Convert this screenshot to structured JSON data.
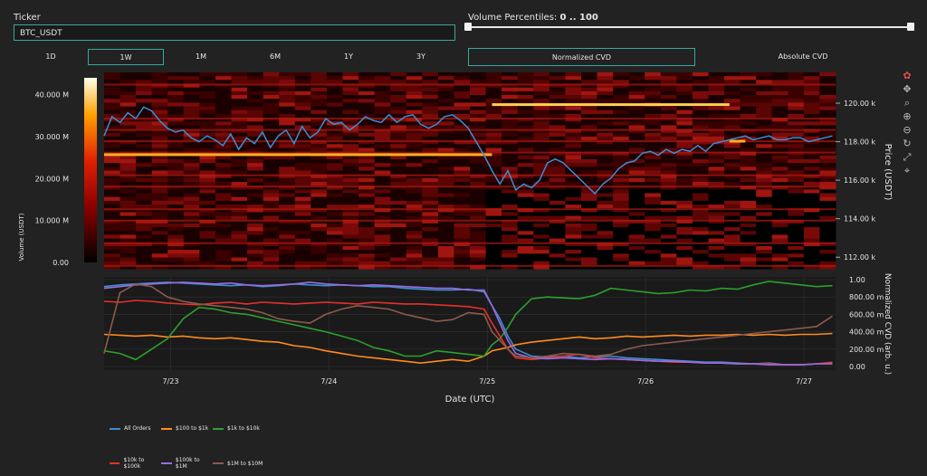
{
  "ticker": {
    "label": "Ticker",
    "value": "BTC_USDT"
  },
  "volume_filter": {
    "label": "Volume Percentiles:",
    "range_text": "0 .. 100",
    "low": 0,
    "high": 100
  },
  "timeframes": [
    {
      "label": "1D",
      "active": false
    },
    {
      "label": "1W",
      "active": true
    },
    {
      "label": "1M",
      "active": false
    },
    {
      "label": "6M",
      "active": false
    },
    {
      "label": "1Y",
      "active": false
    },
    {
      "label": "3Y",
      "active": false
    }
  ],
  "cvd_modes": [
    {
      "label": "Normalized CVD",
      "active": true
    },
    {
      "label": "Absolute CVD",
      "active": false
    }
  ],
  "modebar_icons": [
    "plotly-logo-icon",
    "pan-icon",
    "zoom-icon",
    "zoom-in-icon",
    "zoom-out-icon",
    "reset-icon",
    "autoscale-icon",
    "compare-icon"
  ],
  "colors": {
    "accent": "#38a89d",
    "background": "#222222",
    "plot_bg": "#1a0000"
  },
  "chart_data": [
    {
      "type": "heatmap",
      "title": "",
      "ylabel": "Price (USDT)",
      "colorbar_label": "Volume (USDT)",
      "colorbar_ticks": [
        "0.00",
        "10.000 M",
        "20.000 M",
        "30.000 M",
        "40.000 M"
      ],
      "colorbar_range": [
        0,
        44000000
      ],
      "y_ticks": [
        "112.00 k",
        "114.00 k",
        "116.00 k",
        "118.00 k",
        "120.00 k"
      ],
      "ylim": [
        111400,
        121600
      ],
      "xlim": [
        0,
        4.62
      ],
      "price_series": {
        "name": "Price",
        "color": "#3a8fd6",
        "x": [
          0,
          0.05,
          0.1,
          0.15,
          0.2,
          0.25,
          0.3,
          0.35,
          0.4,
          0.45,
          0.5,
          0.55,
          0.6,
          0.65,
          0.7,
          0.75,
          0.8,
          0.85,
          0.9,
          0.95,
          1.0,
          1.05,
          1.1,
          1.15,
          1.2,
          1.25,
          1.3,
          1.35,
          1.4,
          1.45,
          1.5,
          1.55,
          1.6,
          1.65,
          1.7,
          1.75,
          1.8,
          1.85,
          1.9,
          1.95,
          2.0,
          2.05,
          2.1,
          2.15,
          2.2,
          2.25,
          2.3,
          2.35,
          2.4,
          2.45,
          2.5,
          2.55,
          2.6,
          2.65,
          2.7,
          2.75,
          2.8,
          2.85,
          2.9,
          2.95,
          3.0,
          3.05,
          3.1,
          3.15,
          3.2,
          3.25,
          3.3,
          3.35,
          3.4,
          3.45,
          3.5,
          3.55,
          3.6,
          3.65,
          3.7,
          3.75,
          3.8,
          3.85,
          3.9,
          3.95,
          4.0,
          4.05,
          4.1,
          4.15,
          4.2,
          4.25,
          4.3,
          4.35,
          4.4,
          4.45,
          4.5,
          4.55,
          4.6
        ],
        "y": [
          118300,
          119300,
          119000,
          119500,
          119200,
          119800,
          119600,
          119100,
          118700,
          118500,
          118600,
          118200,
          118000,
          118300,
          118100,
          117800,
          118400,
          117600,
          118200,
          117900,
          118500,
          117700,
          118300,
          118600,
          117900,
          118800,
          118200,
          118500,
          119200,
          118900,
          119000,
          118600,
          118900,
          119300,
          119100,
          119000,
          119400,
          119000,
          119300,
          119400,
          118900,
          118700,
          118900,
          119300,
          119400,
          119100,
          118700,
          118000,
          117300,
          116500,
          115800,
          116500,
          115500,
          115800,
          115600,
          116000,
          116900,
          117100,
          116900,
          116500,
          116100,
          115700,
          115300,
          115800,
          116100,
          116600,
          116900,
          117000,
          117400,
          117500,
          117300,
          117600,
          117400,
          117600,
          117500,
          117800,
          117500,
          117900,
          118000,
          118100,
          118200,
          118300,
          118100,
          118200,
          118300,
          118100,
          118100,
          118200,
          118200,
          118000,
          118100,
          118200,
          118300
        ]
      },
      "bright_levels": [
        {
          "price": 117350,
          "x_start": 0,
          "x_end": 2.45,
          "color": "#ffb020"
        },
        {
          "price": 119950,
          "x_start": 2.45,
          "x_end": 3.95,
          "color": "#ffd24a"
        },
        {
          "price": 118050,
          "x_start": 3.95,
          "x_end": 4.05,
          "color": "#ffb020"
        }
      ]
    },
    {
      "type": "line",
      "title": "",
      "xlabel": "Date (UTC)",
      "ylabel": "Normalized CVD (arb. u.)",
      "x_ticks": [
        {
          "label": "7/23",
          "x": 0.42
        },
        {
          "label": "7/24",
          "x": 1.42
        },
        {
          "label": "7/25",
          "x": 2.42
        },
        {
          "label": "7/26",
          "x": 3.42
        },
        {
          "label": "7/27",
          "x": 4.42
        }
      ],
      "y_ticks": [
        "0.00",
        "200.00 m",
        "400.00 m",
        "600.00 m",
        "800.00 m",
        "1.00"
      ],
      "ylim": [
        -0.05,
        1.05
      ],
      "xlim": [
        0,
        4.62
      ],
      "legend_position": "bottom",
      "x": [
        0,
        0.1,
        0.2,
        0.3,
        0.4,
        0.5,
        0.6,
        0.7,
        0.8,
        0.9,
        1.0,
        1.1,
        1.2,
        1.3,
        1.4,
        1.5,
        1.6,
        1.7,
        1.8,
        1.9,
        2.0,
        2.1,
        2.2,
        2.3,
        2.4,
        2.45,
        2.5,
        2.55,
        2.6,
        2.7,
        2.8,
        2.9,
        3.0,
        3.1,
        3.2,
        3.3,
        3.4,
        3.5,
        3.6,
        3.7,
        3.8,
        3.9,
        4.0,
        4.1,
        4.2,
        4.3,
        4.4,
        4.5,
        4.6
      ],
      "series": [
        {
          "name": "All Orders",
          "color": "#3a8fd6",
          "values": [
            0.92,
            0.94,
            0.95,
            0.96,
            0.97,
            0.96,
            0.95,
            0.94,
            0.93,
            0.94,
            0.92,
            0.93,
            0.95,
            0.94,
            0.93,
            0.94,
            0.93,
            0.92,
            0.92,
            0.9,
            0.89,
            0.88,
            0.88,
            0.89,
            0.86,
            0.7,
            0.55,
            0.35,
            0.2,
            0.12,
            0.11,
            0.12,
            0.1,
            0.11,
            0.12,
            0.1,
            0.09,
            0.08,
            0.07,
            0.06,
            0.05,
            0.05,
            0.04,
            0.03,
            0.04,
            0.02,
            0.02,
            0.03,
            0.04
          ]
        },
        {
          "name": "$100 to $1k",
          "color": "#ff8a1f",
          "values": [
            0.37,
            0.36,
            0.35,
            0.36,
            0.34,
            0.35,
            0.33,
            0.32,
            0.33,
            0.31,
            0.29,
            0.28,
            0.24,
            0.22,
            0.18,
            0.15,
            0.12,
            0.1,
            0.08,
            0.06,
            0.04,
            0.06,
            0.08,
            0.06,
            0.12,
            0.18,
            0.2,
            0.22,
            0.25,
            0.28,
            0.3,
            0.32,
            0.34,
            0.32,
            0.33,
            0.35,
            0.34,
            0.35,
            0.36,
            0.35,
            0.36,
            0.36,
            0.37,
            0.36,
            0.37,
            0.36,
            0.37,
            0.37,
            0.38
          ]
        },
        {
          "name": "$1k to $10k",
          "color": "#2ca02c",
          "values": [
            0.18,
            0.15,
            0.08,
            0.2,
            0.32,
            0.55,
            0.68,
            0.66,
            0.62,
            0.6,
            0.56,
            0.52,
            0.48,
            0.44,
            0.4,
            0.35,
            0.3,
            0.22,
            0.18,
            0.12,
            0.12,
            0.18,
            0.16,
            0.14,
            0.12,
            0.25,
            0.32,
            0.45,
            0.6,
            0.78,
            0.8,
            0.79,
            0.78,
            0.82,
            0.9,
            0.88,
            0.86,
            0.84,
            0.85,
            0.88,
            0.87,
            0.9,
            0.89,
            0.94,
            0.98,
            0.96,
            0.94,
            0.92,
            0.93
          ]
        },
        {
          "name": "$10k to $100k",
          "color": "#e8302a",
          "values": [
            0.75,
            0.74,
            0.76,
            0.75,
            0.73,
            0.72,
            0.71,
            0.73,
            0.74,
            0.72,
            0.74,
            0.73,
            0.72,
            0.73,
            0.74,
            0.73,
            0.72,
            0.74,
            0.73,
            0.72,
            0.72,
            0.71,
            0.7,
            0.69,
            0.66,
            0.5,
            0.35,
            0.2,
            0.1,
            0.08,
            0.1,
            0.12,
            0.14,
            0.1,
            0.09,
            0.08,
            0.07,
            0.06,
            0.05,
            0.05,
            0.04,
            0.04,
            0.03,
            0.03,
            0.03,
            0.02,
            0.02,
            0.03,
            0.05
          ]
        },
        {
          "name": "$100k to $1M",
          "color": "#9b6be0",
          "values": [
            0.9,
            0.92,
            0.94,
            0.95,
            0.96,
            0.97,
            0.96,
            0.95,
            0.96,
            0.94,
            0.93,
            0.94,
            0.95,
            0.97,
            0.95,
            0.94,
            0.93,
            0.94,
            0.93,
            0.92,
            0.91,
            0.9,
            0.9,
            0.88,
            0.88,
            0.7,
            0.5,
            0.3,
            0.15,
            0.1,
            0.09,
            0.1,
            0.09,
            0.08,
            0.09,
            0.08,
            0.07,
            0.06,
            0.06,
            0.05,
            0.04,
            0.04,
            0.03,
            0.03,
            0.02,
            0.02,
            0.02,
            0.03,
            0.03
          ]
        },
        {
          "name": "$1M to $10M",
          "color": "#8c5a4e",
          "values": [
            0.15,
            0.85,
            0.95,
            0.92,
            0.8,
            0.75,
            0.72,
            0.7,
            0.68,
            0.66,
            0.62,
            0.55,
            0.52,
            0.5,
            0.6,
            0.66,
            0.7,
            0.68,
            0.66,
            0.6,
            0.56,
            0.52,
            0.54,
            0.62,
            0.6,
            0.4,
            0.3,
            0.2,
            0.12,
            0.1,
            0.12,
            0.15,
            0.14,
            0.12,
            0.14,
            0.2,
            0.24,
            0.26,
            0.28,
            0.3,
            0.32,
            0.34,
            0.36,
            0.38,
            0.4,
            0.42,
            0.44,
            0.46,
            0.58
          ]
        }
      ]
    }
  ]
}
